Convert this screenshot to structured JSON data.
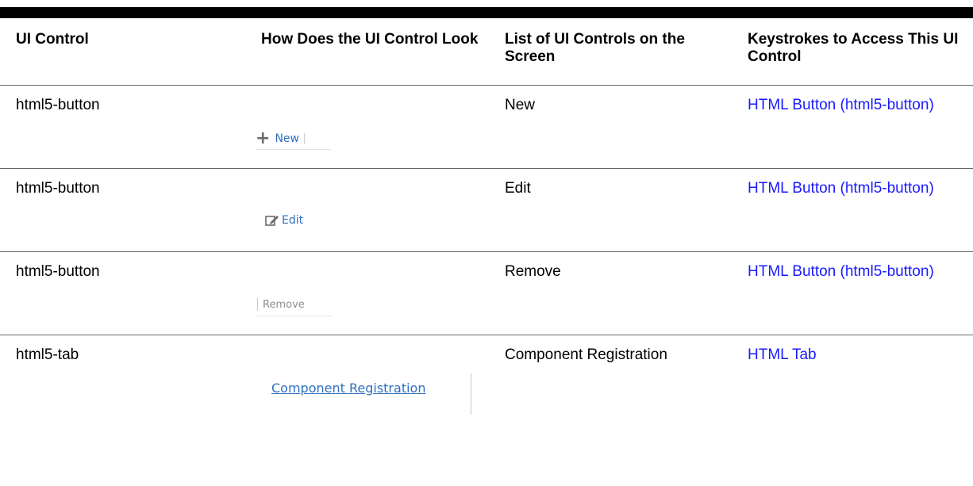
{
  "headers": {
    "col1": "UI Control",
    "col2": "How Does the UI Control Look",
    "col3": "List of UI Controls on the Screen",
    "col4": "Keystrokes to Access This UI Control"
  },
  "rows": [
    {
      "control": "html5-button",
      "preview": {
        "icon": "plus-icon",
        "label": "New"
      },
      "list": "New",
      "keystroke": "HTML Button (html5-button)"
    },
    {
      "control": "html5-button",
      "preview": {
        "icon": "edit-icon",
        "label": "Edit"
      },
      "list": "Edit",
      "keystroke": "HTML Button (html5-button)"
    },
    {
      "control": "html5-button",
      "preview": {
        "label": "Remove"
      },
      "list": "Remove",
      "keystroke": "HTML Button (html5-button)"
    },
    {
      "control": "html5-tab",
      "preview": {
        "label": "Component Registration"
      },
      "list": "Component Registration",
      "keystroke": "HTML Tab"
    }
  ],
  "colors": {
    "link": "#1a1aff",
    "preview_link": "#2e6fc0",
    "rule": "#666666"
  }
}
